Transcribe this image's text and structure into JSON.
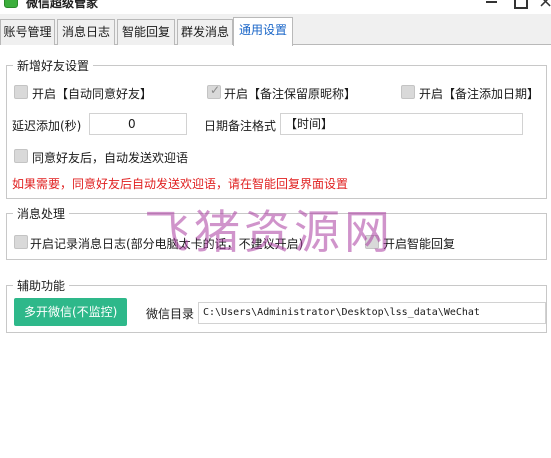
{
  "window": {
    "title": "微信超级管家"
  },
  "tabs": [
    "账号管理",
    "消息日志",
    "智能回复",
    "群发消息",
    "通用设置"
  ],
  "groups": {
    "add_friend": {
      "title": "新增好友设置",
      "chk_auto_accept": "开启【自动同意好友】",
      "chk_keep_nickname": "开启【备注保留原昵称】",
      "chk_add_date": "开启【备注添加日期】",
      "delay_label": "延迟添加(秒)",
      "delay_value": "0",
      "date_format_label": "日期备注格式",
      "date_format_value": "【时间】",
      "chk_welcome": "同意好友后，自动发送欢迎语",
      "hint": "如果需要，同意好友后自动发送欢迎语，请在智能回复界面设置"
    },
    "message": {
      "title": "消息处理",
      "chk_log": "开启记录消息日志(部分电脑太卡的话，不建议开启)",
      "chk_smart_reply": "开启智能回复"
    },
    "aux": {
      "title": "辅助功能",
      "multi_button": "多开微信(不监控)",
      "dir_label": "微信目录",
      "dir_value": "C:\\Users\\Administrator\\Desktop\\lss_data\\WeChat"
    }
  },
  "watermark": "飞猪资源网",
  "checks": {
    "auto_accept": false,
    "keep_nickname": true,
    "add_date": false,
    "welcome": false,
    "log": false,
    "smart_reply": false
  },
  "colors": {
    "accent": "#2eb88a",
    "warning": "#e02020",
    "active_tab": "#1a66c8"
  }
}
